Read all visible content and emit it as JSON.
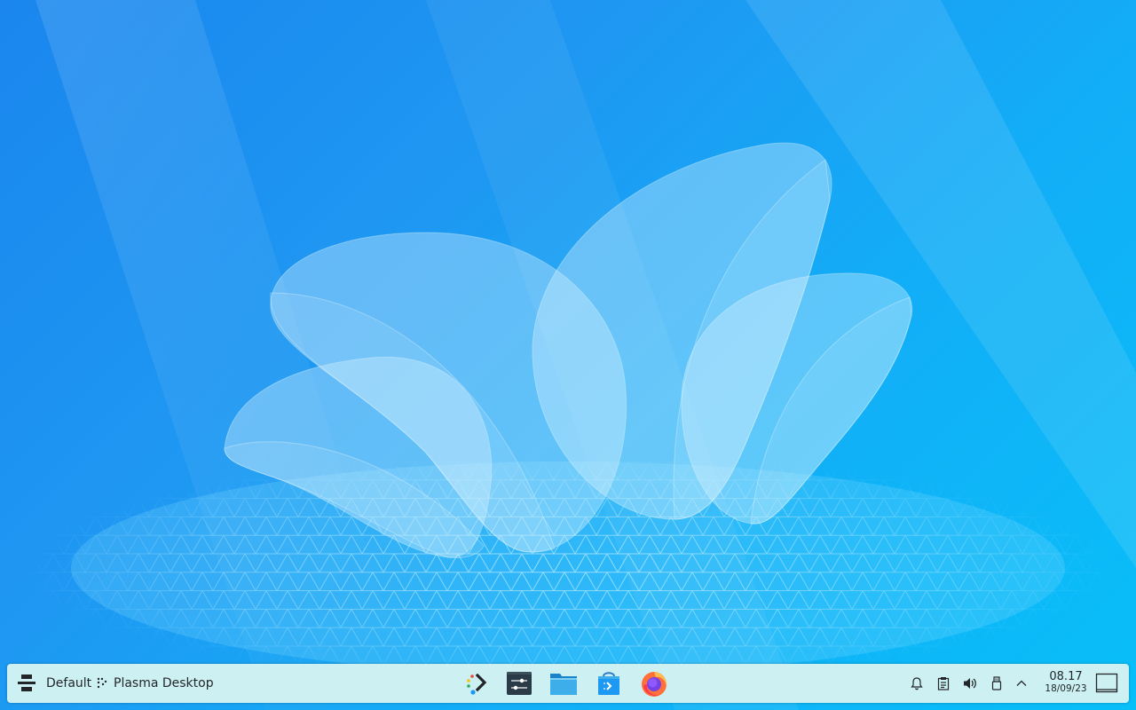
{
  "panel": {
    "activity_icon": "activity-switcher-icon",
    "activity_label": "Default",
    "desktop_icon": "plasma-desktop-icon",
    "desktop_label": "Plasma Desktop"
  },
  "taskbar": {
    "apps": [
      {
        "name": "kickoff-launcher-icon"
      },
      {
        "name": "system-settings-icon"
      },
      {
        "name": "dolphin-file-manager-icon"
      },
      {
        "name": "discover-store-icon"
      },
      {
        "name": "firefox-icon"
      }
    ]
  },
  "tray": {
    "icons": [
      "notifications-bell-icon",
      "clipboard-icon",
      "volume-icon",
      "usb-device-icon",
      "chevron-up-icon"
    ]
  },
  "clock": {
    "time": "08.17",
    "date": "18/09/23"
  },
  "colors": {
    "panel_bg": "#cdf0f3",
    "wallpaper_start": "#1a86ee",
    "wallpaper_end": "#08bff8"
  }
}
